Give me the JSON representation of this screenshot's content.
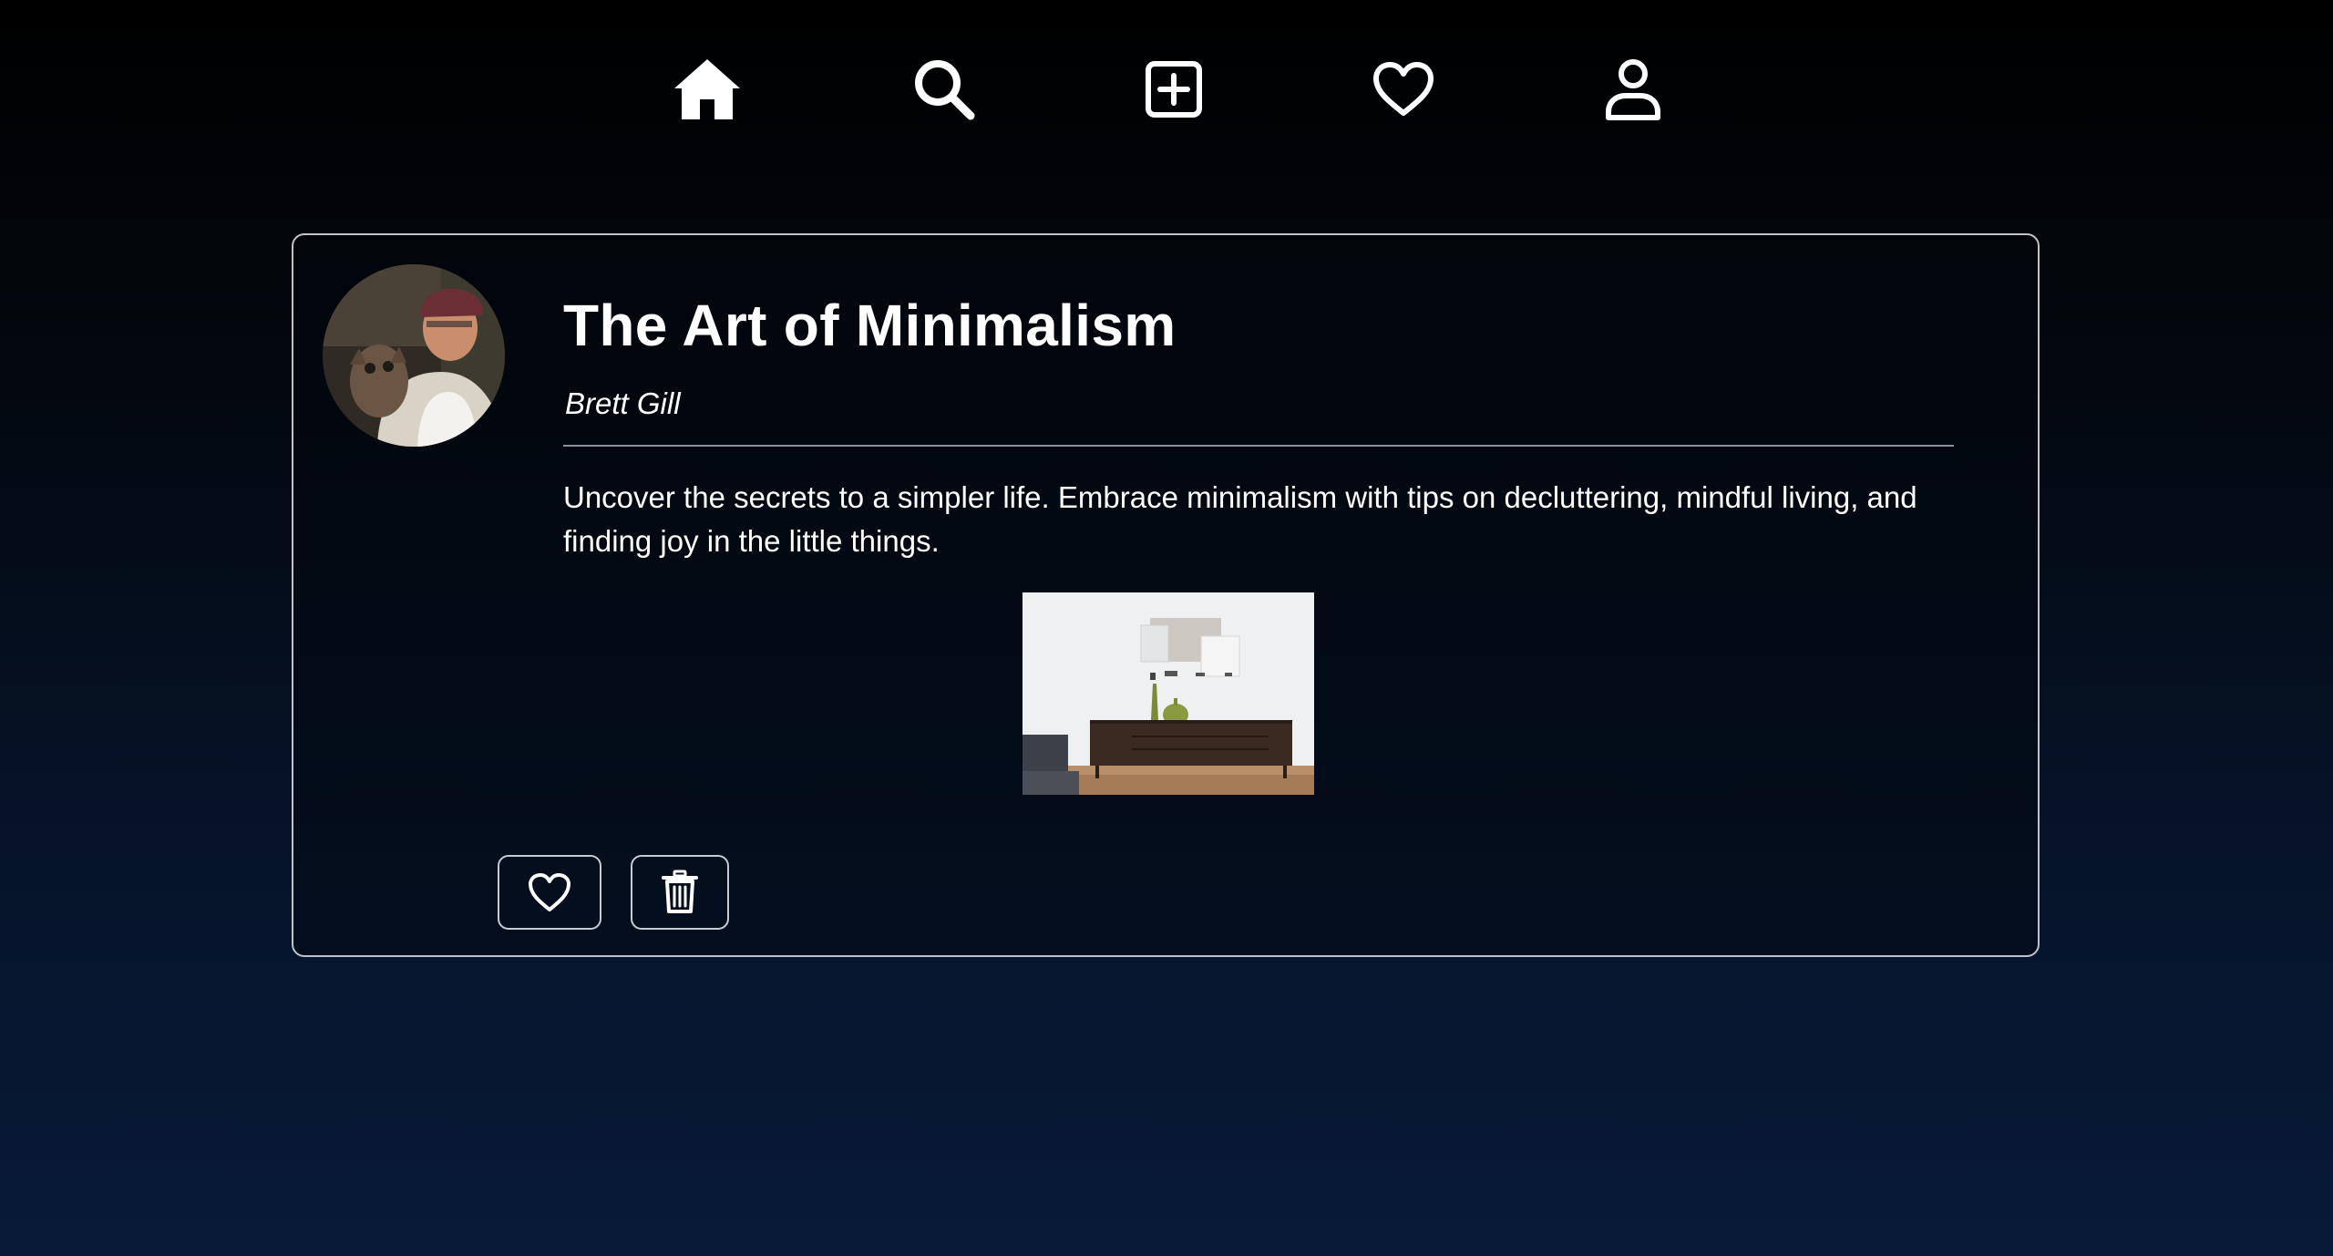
{
  "nav": {
    "items": [
      {
        "icon": "home-icon"
      },
      {
        "icon": "search-icon"
      },
      {
        "icon": "add-post-icon"
      },
      {
        "icon": "heart-icon"
      },
      {
        "icon": "user-icon"
      }
    ]
  },
  "post": {
    "title": "The Art of Minimalism",
    "author": "Brett Gill",
    "body": "Uncover the secrets to a simpler life. Embrace minimalism with tips on decluttering, mindful living, and finding joy in the little things.",
    "actions": {
      "like_icon": "heart-outline-icon",
      "delete_icon": "trash-icon"
    }
  },
  "colors": {
    "background_top": "#000000",
    "background_bottom": "#081a38",
    "card_border": "#bfc3cc",
    "text": "#ffffff"
  }
}
